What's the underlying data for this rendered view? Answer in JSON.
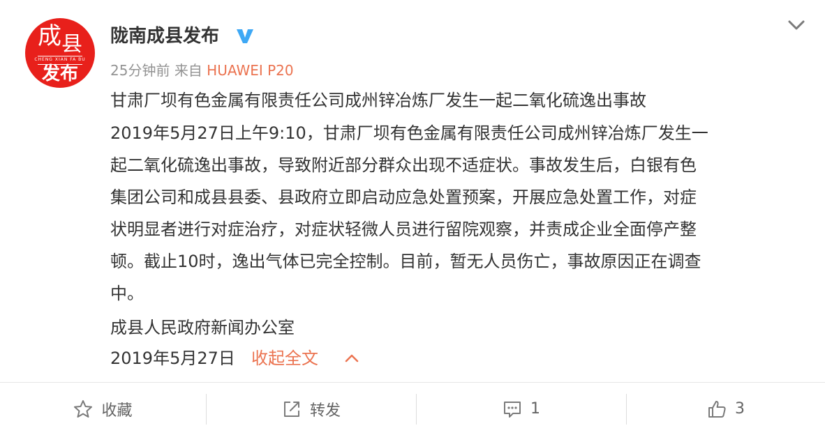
{
  "account": {
    "name": "陇南成县发布",
    "avatar_text_top_left": "成",
    "avatar_text_top_right": "县",
    "avatar_pinyin": "CHENG XIAN FA BU",
    "avatar_text_bottom": "发布"
  },
  "meta": {
    "time": "25分钟前",
    "source_prefix": "来自",
    "device": "HUAWEI P20"
  },
  "post": {
    "title": "甘肃厂坝有色金属有限责任公司成州锌冶炼厂发生一起二氧化硫逸出事故",
    "lines": [
      "2019年5月27日上午9:10，甘肃厂坝有色金属有限责任公司成州锌冶炼厂发生一",
      "起二氧化硫逸出事故，导致附近部分群众出现不适症状。事故发生后，白银有色",
      "集团公司和成县县委、县政府立即启动应急处置预案，开展应急处置工作，对症",
      "状明显者进行对症治疗，对症状轻微人员进行留院观察，并责成企业全面停产整",
      "顿。截止10时，逸出气体已完全控制。目前，暂无人员伤亡，事故原因正在调查",
      "中。"
    ],
    "signature": "成县人民政府新闻办公室",
    "date": "2019年5月27日",
    "collapse_label": "收起全文"
  },
  "actions": {
    "favorite_label": "收藏",
    "repost_label": "转发",
    "comment_count": "1",
    "like_count": "3"
  },
  "colors": {
    "accent": "#eb7350",
    "verified": "#3ea8f5",
    "avatar_bg": "#e8201b",
    "meta_gray": "#939393"
  },
  "icons": {
    "verified": "verified-v-icon",
    "more": "chevron-down-icon",
    "collapse": "chevron-up-icon",
    "favorite": "star-icon",
    "repost": "share-arrow-icon",
    "comment": "comment-bubble-icon",
    "like": "thumbs-up-icon"
  }
}
